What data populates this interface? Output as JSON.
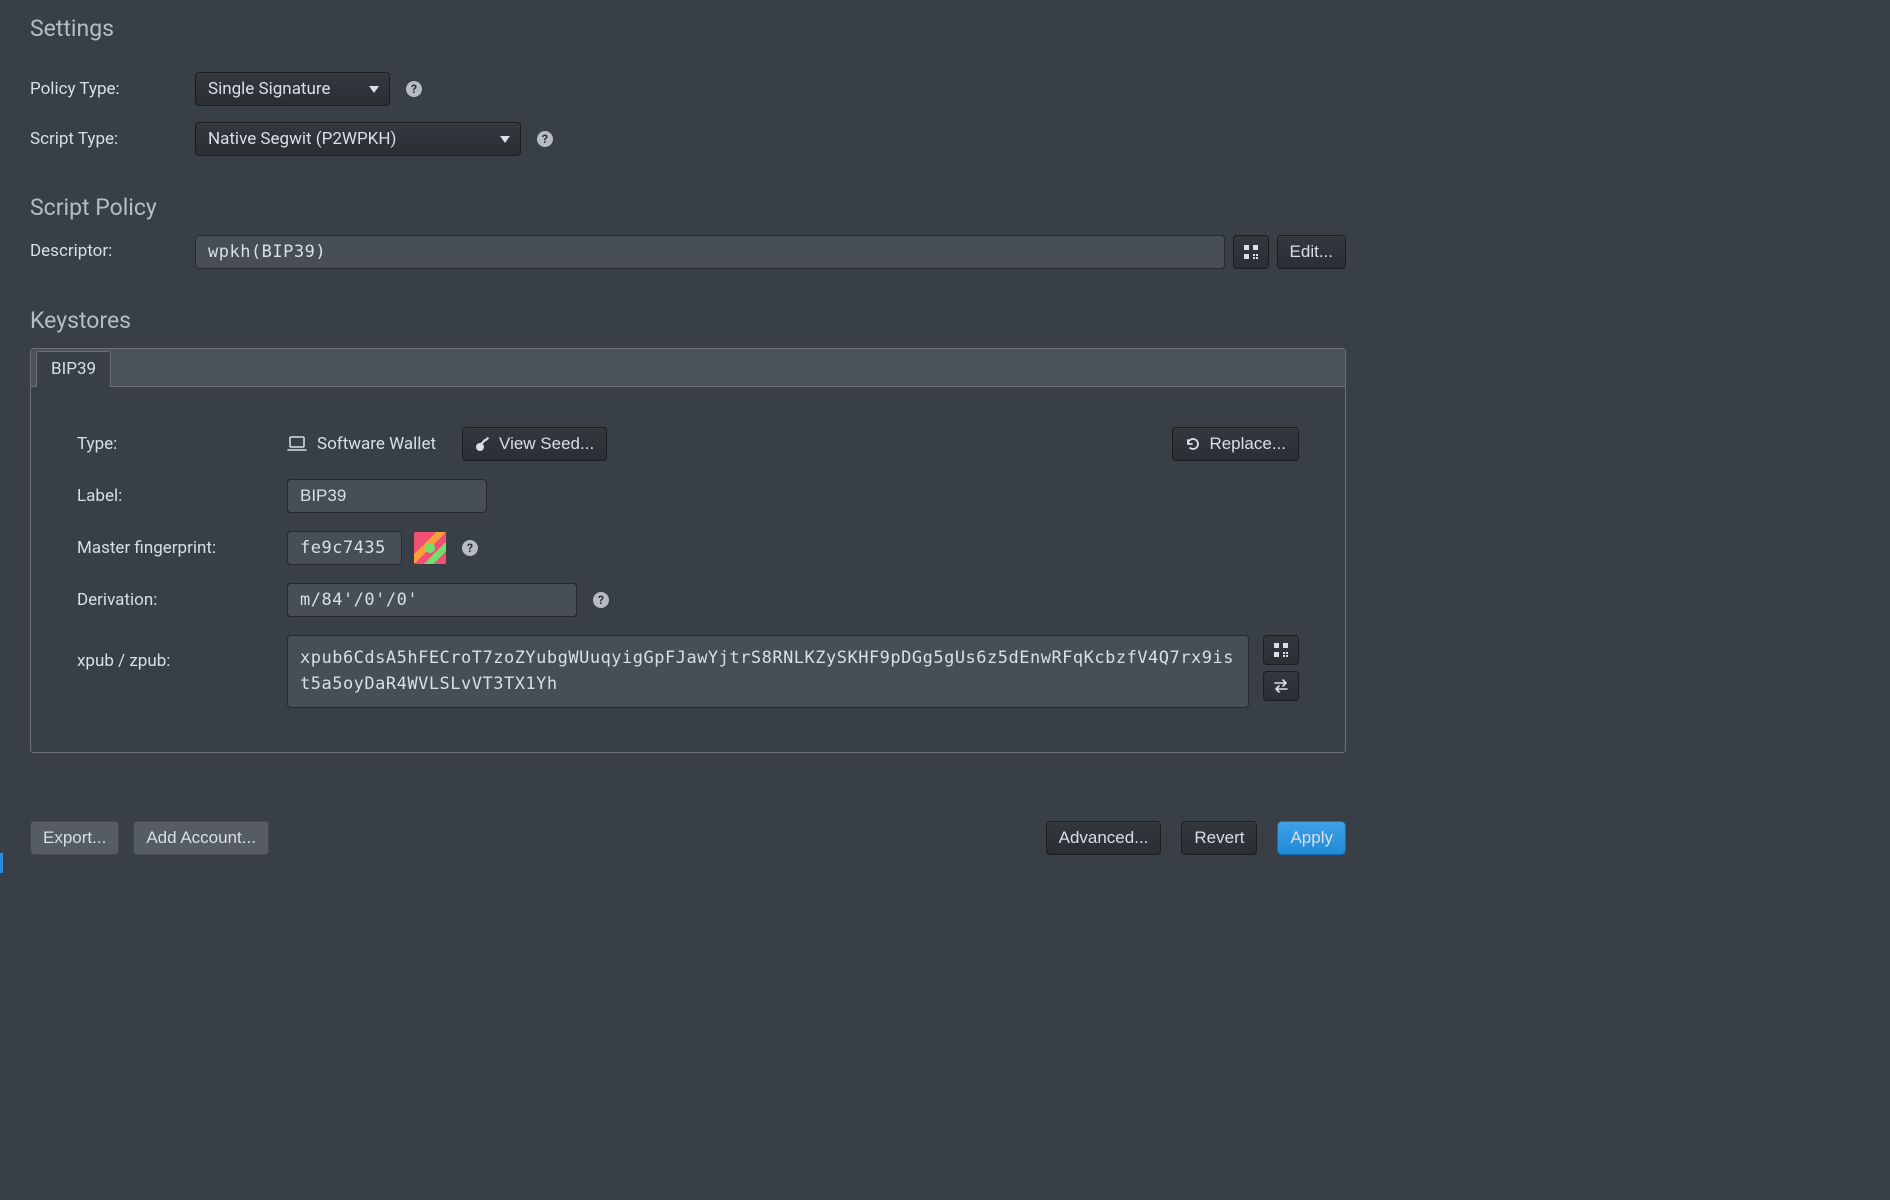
{
  "settings": {
    "title": "Settings",
    "policy_label": "Policy Type:",
    "policy_value": "Single Signature",
    "script_label": "Script Type:",
    "script_value": "Native Segwit (P2WPKH)"
  },
  "script_policy": {
    "title": "Script Policy",
    "descriptor_label": "Descriptor:",
    "descriptor_value": "wpkh(BIP39)",
    "edit_label": "Edit..."
  },
  "keystores": {
    "title": "Keystores",
    "tab_label": "BIP39",
    "type_label": "Type:",
    "type_value": "Software Wallet",
    "view_seed_label": "View Seed...",
    "replace_label": "Replace...",
    "label_label": "Label:",
    "label_value": "BIP39",
    "fingerprint_label": "Master fingerprint:",
    "fingerprint_value": "fe9c7435",
    "derivation_label": "Derivation:",
    "derivation_value": "m/84'/0'/0'",
    "xpub_label": "xpub / zpub:",
    "xpub_value": "xpub6CdsA5hFECroT7zoZYubgWUuqyigGpFJawYjtrS8RNLKZySKHF9pDGg5gUs6z5dEnwRFqKcbzfV4Q7rx9ist5a5oyDaR4WVLSLvVT3TX1Yh"
  },
  "footer": {
    "export_label": "Export...",
    "add_account_label": "Add Account...",
    "advanced_label": "Advanced...",
    "revert_label": "Revert",
    "apply_label": "Apply"
  }
}
